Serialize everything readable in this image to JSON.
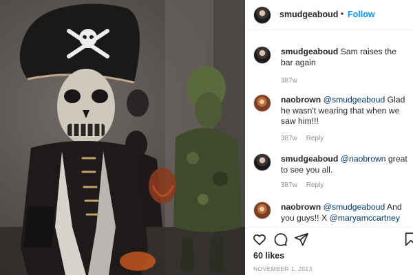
{
  "post": {
    "image_alt": "Children in Halloween costumes: pirate skull mask and camouflage outfit",
    "hat_emblem": "skull-and-crossbones"
  },
  "header": {
    "username": "smudgeaboud",
    "separator": "•",
    "follow_label": "Follow"
  },
  "comments": [
    {
      "avatar": "smudgeaboud-avatar",
      "username": "smudgeaboud",
      "mention": "",
      "text": "Sam raises the bar again",
      "mention2": "",
      "text2": "",
      "time": "387w",
      "reply": ""
    },
    {
      "avatar": "naobrown-avatar",
      "username": "naobrown",
      "mention": "@smudgeaboud",
      "text": "Glad he wasn't wearing that when we saw him!!!",
      "mention2": "",
      "text2": "",
      "time": "387w",
      "reply": "Reply"
    },
    {
      "avatar": "smudgeaboud-avatar",
      "username": "smudgeaboud",
      "mention": "@naobrown",
      "text": "great to see you all.",
      "mention2": "",
      "text2": "",
      "time": "387w",
      "reply": "Reply"
    },
    {
      "avatar": "naobrown-avatar",
      "username": "naobrown",
      "mention": "@smudgeaboud",
      "text": "And you guys!! X",
      "mention2": "@maryamccartney",
      "text2": "",
      "time": "",
      "reply": ""
    }
  ],
  "footer": {
    "likes": "60 likes",
    "date": "NOVEMBER 1, 2013",
    "icons": [
      "heart-icon",
      "comment-icon",
      "share-icon",
      "bookmark-icon"
    ]
  },
  "colors": {
    "link_blue": "#0095f6",
    "mention_blue": "#00376b",
    "text": "#262626",
    "muted": "#8e8e8e"
  }
}
